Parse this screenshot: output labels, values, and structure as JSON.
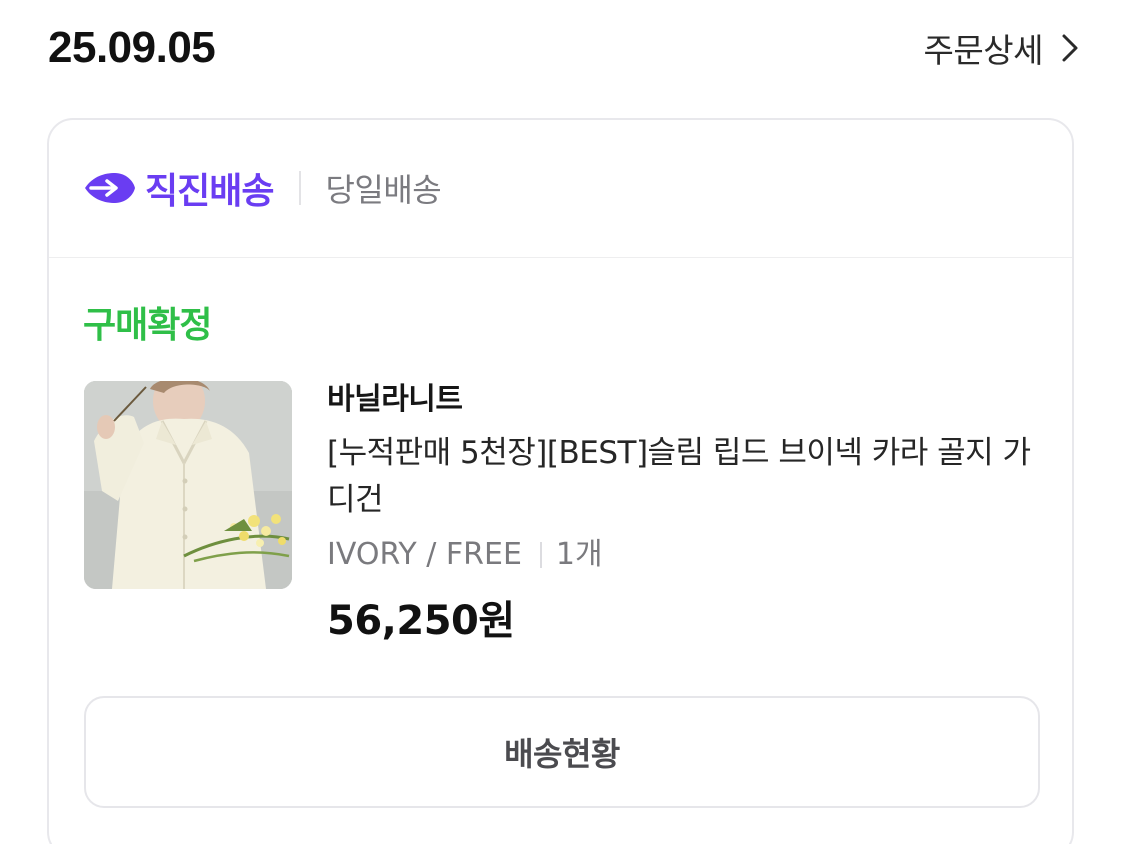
{
  "order": {
    "date": "25.09.05",
    "detail_label": "주문상세"
  },
  "delivery": {
    "brand_label": "직진배송",
    "type_label": "당일배송",
    "brand_color": "#6a3df2"
  },
  "status": {
    "label": "구매확정",
    "color": "#2fbf48"
  },
  "product": {
    "brand": "바닐라니트",
    "name": "[누적판매 5천장][BEST]슬림 립드 브이넥 카라 골지 가디건",
    "option": "IVORY / FREE",
    "quantity": "1개",
    "price": "56,250원"
  },
  "actions": {
    "track_label": "배송현황"
  },
  "icons": {
    "detail_chevron": "chevron-right-icon",
    "delivery_logo": "fast-delivery-arrow-icon"
  }
}
